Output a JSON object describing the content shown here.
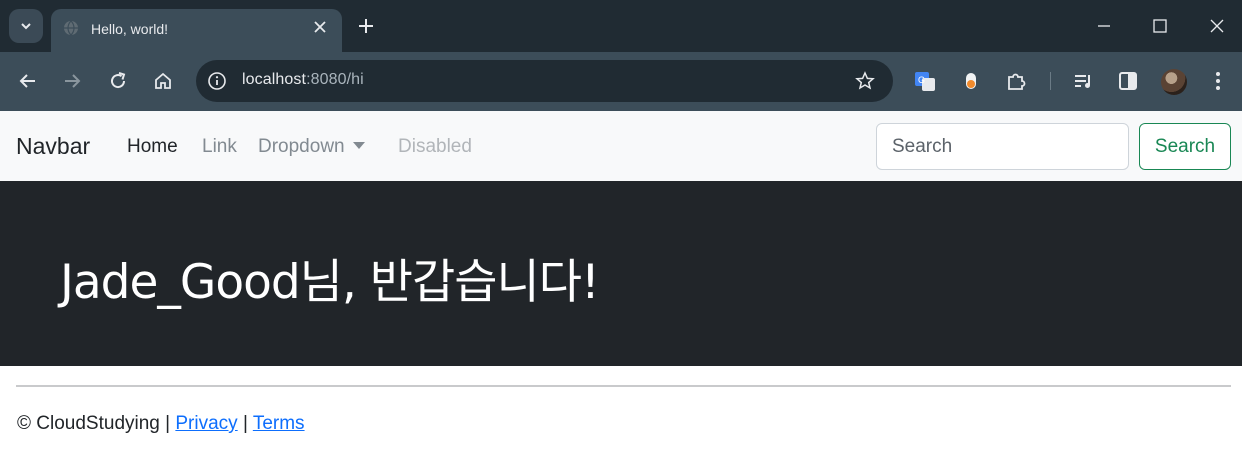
{
  "browser": {
    "tab": {
      "title": "Hello, world!"
    },
    "address": {
      "host": "localhost",
      "path": ":8080/hi"
    }
  },
  "navbar": {
    "brand": "Navbar",
    "links": [
      {
        "label": "Home",
        "state": "active"
      },
      {
        "label": "Link",
        "state": "normal"
      },
      {
        "label": "Dropdown",
        "state": "normal"
      },
      {
        "label": "Disabled",
        "state": "disabled"
      }
    ],
    "search": {
      "placeholder": "Search",
      "button_label": "Search"
    }
  },
  "hero": {
    "greeting": "Jade_Good님, 반갑습니다!"
  },
  "footer": {
    "copyright": "© CloudStudying",
    "separator": "|",
    "privacy": "Privacy",
    "terms": "Terms"
  },
  "colors": {
    "chrome_dark": "#202b33",
    "chrome_toolbar": "#3c4d59",
    "hero_bg": "#212529",
    "success": "#198754",
    "link": "#0d6efd"
  },
  "icons": [
    "tab-search-icon",
    "globe-icon",
    "close-icon",
    "plus-icon",
    "minimize-icon",
    "maximize-icon",
    "back-icon",
    "forward-icon",
    "reload-icon",
    "home-icon",
    "info-icon",
    "star-icon",
    "translate-icon",
    "extension-dot-icon",
    "puzzle-icon",
    "media-icon",
    "sidepanel-icon",
    "kebab-icon"
  ]
}
